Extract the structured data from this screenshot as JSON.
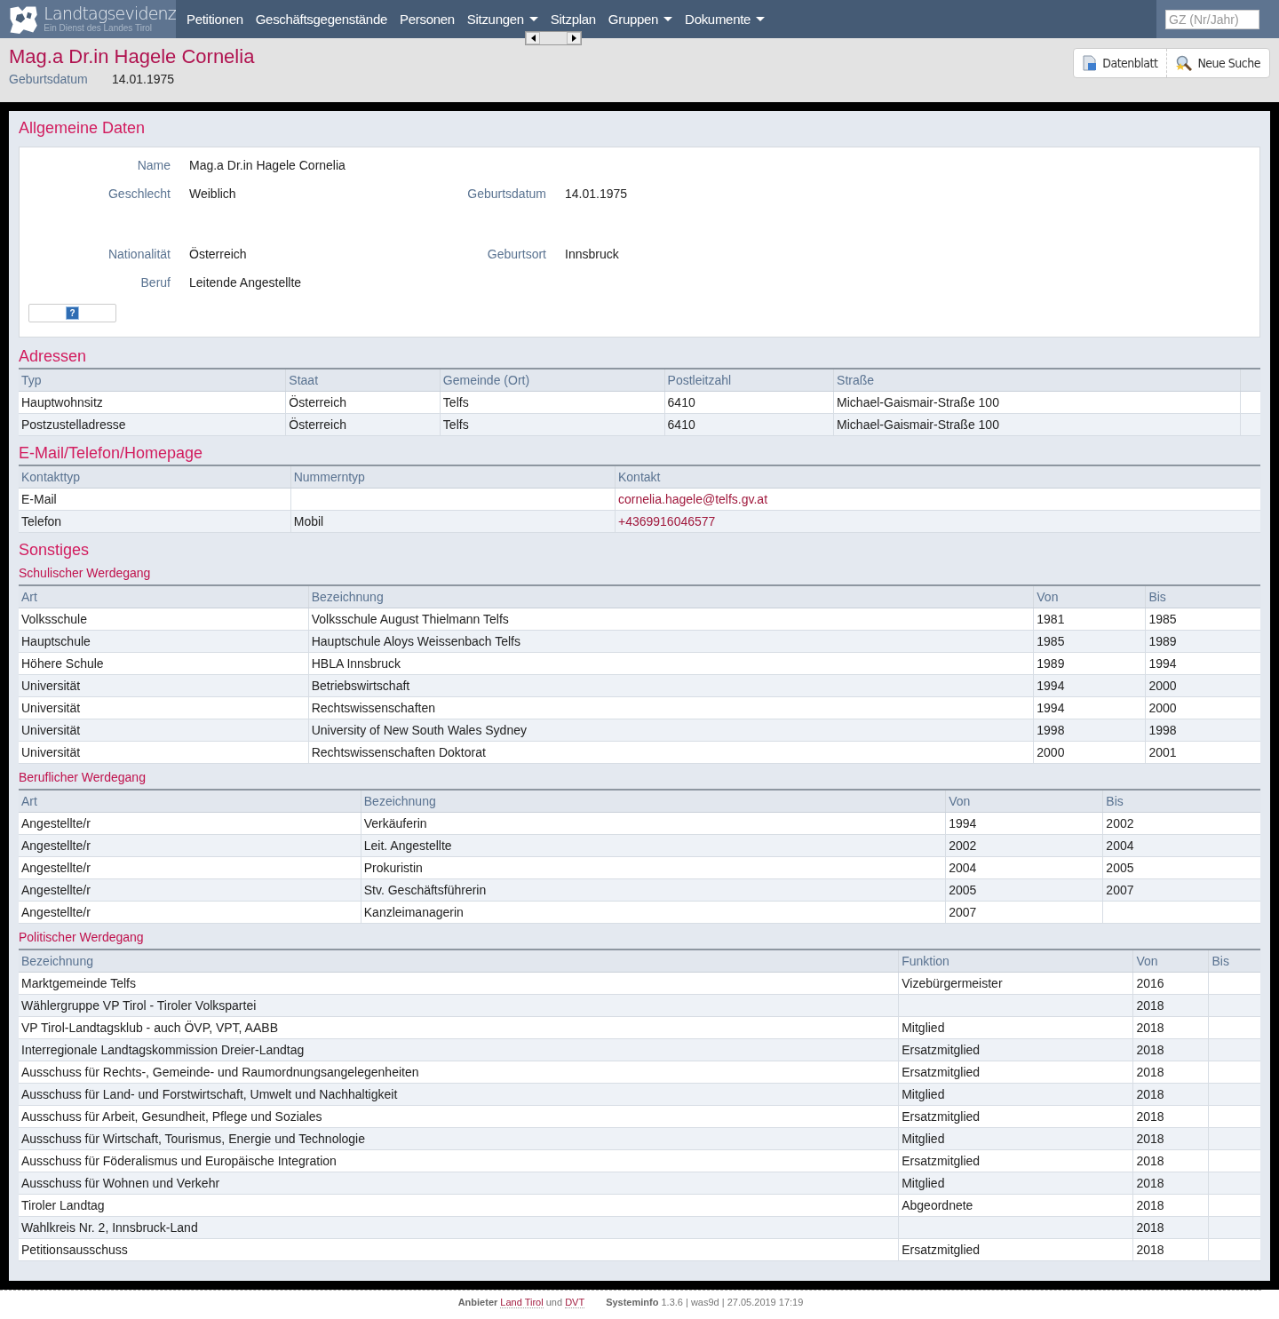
{
  "nav": {
    "brand": "Landtagsevidenz",
    "brand_sub": "Ein Dienst des Landes Tirol",
    "items": [
      {
        "label": "Petitionen",
        "dropdown": false
      },
      {
        "label": "Geschäftsgegenstände",
        "dropdown": false
      },
      {
        "label": "Personen",
        "dropdown": false
      },
      {
        "label": "Sitzungen",
        "dropdown": true
      },
      {
        "label": "Sitzplan",
        "dropdown": false
      },
      {
        "label": "Gruppen",
        "dropdown": true
      },
      {
        "label": "Dokumente",
        "dropdown": true
      }
    ],
    "search": {
      "placeholder": "GZ (Nr/Jahr)"
    }
  },
  "header": {
    "title": "Mag.a Dr.in Hagele Cornelia",
    "birth_label": "Geburtsdatum",
    "birth_value": "14.01.1975",
    "buttons": [
      "Datenblatt",
      "Neue Suche"
    ]
  },
  "general": {
    "title": "Allgemeine Daten",
    "rows": [
      [
        {
          "label": "Name",
          "value": "Mag.a Dr.in Hagele Cornelia"
        }
      ],
      [
        {
          "label": "Geschlecht",
          "value": "Weiblich"
        },
        {
          "label": "Geburtsdatum",
          "value": "14.01.1975"
        }
      ],
      [],
      [
        {
          "label": "Nationalität",
          "value": "Österreich"
        },
        {
          "label": "Geburtsort",
          "value": "Innsbruck"
        }
      ],
      [
        {
          "label": "Beruf",
          "value": "Leitende Angestellte"
        }
      ]
    ],
    "help": "?"
  },
  "addresses": {
    "title": "Adressen",
    "columns": [
      "Typ",
      "Staat",
      "Gemeinde (Ort)",
      "Postleitzahl",
      "Straße"
    ],
    "extra_column": true,
    "rows": [
      [
        "Hauptwohnsitz",
        "Österreich",
        "Telfs",
        "6410",
        "Michael-Gaismair-Straße 100"
      ],
      [
        "Postzustelladresse",
        "Österreich",
        "Telfs",
        "6410",
        "Michael-Gaismair-Straße 100"
      ]
    ]
  },
  "contacts": {
    "title": "E-Mail/Telefon/Homepage",
    "columns": [
      "Kontakttyp",
      "Nummerntyp",
      "Kontakt"
    ],
    "rows": [
      {
        "type": "E-Mail",
        "number_type": "",
        "contact": "cornelia.hagele@telfs.gv.at"
      },
      {
        "type": "Telefon",
        "number_type": "Mobil",
        "contact": "+4369916046577"
      }
    ]
  },
  "other": {
    "title": "Sonstiges",
    "tables": [
      {
        "title": "Schulischer Werdegang",
        "columns": [
          "Art",
          "Bezeichnung",
          "Von",
          "Bis"
        ],
        "rows": [
          [
            "Volksschule",
            "Volksschule August Thielmann Telfs",
            "1981",
            "1985"
          ],
          [
            "Hauptschule",
            "Hauptschule Aloys Weissenbach Telfs",
            "1985",
            "1989"
          ],
          [
            "Höhere Schule",
            "HBLA Innsbruck",
            "1989",
            "1994"
          ],
          [
            "Universität",
            "Betriebswirtschaft",
            "1994",
            "2000"
          ],
          [
            "Universität",
            "Rechtswissenschaften",
            "1994",
            "2000"
          ],
          [
            "Universität",
            "University of New South Wales Sydney",
            "1998",
            "1998"
          ],
          [
            "Universität",
            "Rechtswissenschaften Doktorat",
            "2000",
            "2001"
          ]
        ]
      },
      {
        "title": "Beruflicher Werdegang",
        "columns": [
          "Art",
          "Bezeichnung",
          "Von",
          "Bis"
        ],
        "rows": [
          [
            "Angestellte/r",
            "Verkäuferin",
            "1994",
            "2002"
          ],
          [
            "Angestellte/r",
            "Leit. Angestellte",
            "2002",
            "2004"
          ],
          [
            "Angestellte/r",
            "Prokuristin",
            "2004",
            "2005"
          ],
          [
            "Angestellte/r",
            "Stv. Geschäftsführerin",
            "2005",
            "2007"
          ],
          [
            "Angestellte/r",
            "Kanzleimanagerin",
            "2007",
            ""
          ]
        ]
      },
      {
        "title": "Politischer Werdegang",
        "columns": [
          "Bezeichnung",
          "Funktion",
          "Von",
          "Bis"
        ],
        "rows": [
          [
            "Marktgemeinde Telfs",
            "Vizebürgermeister",
            "2016",
            ""
          ],
          [
            "Wählergruppe VP Tirol - Tiroler Volkspartei",
            "",
            "2018",
            ""
          ],
          [
            "VP Tirol-Landtagsklub - auch ÖVP, VPT, AABB",
            "Mitglied",
            "2018",
            ""
          ],
          [
            "Interregionale Landtagskommission Dreier-Landtag",
            "Ersatzmitglied",
            "2018",
            ""
          ],
          [
            "Ausschuss für Rechts-, Gemeinde- und Raumordnungsangelegenheiten",
            "Ersatzmitglied",
            "2018",
            ""
          ],
          [
            "Ausschuss für Land- und Forstwirtschaft, Umwelt und Nachhaltigkeit",
            "Mitglied",
            "2018",
            ""
          ],
          [
            "Ausschuss für Arbeit, Gesundheit, Pflege und Soziales",
            "Ersatzmitglied",
            "2018",
            ""
          ],
          [
            "Ausschuss für Wirtschaft, Tourismus, Energie und Technologie",
            "Mitglied",
            "2018",
            ""
          ],
          [
            "Ausschuss für Föderalismus und Europäische Integration",
            "Ersatzmitglied",
            "2018",
            ""
          ],
          [
            "Ausschuss für Wohnen und Verkehr",
            "Mitglied",
            "2018",
            ""
          ],
          [
            "Tiroler Landtag",
            "Abgeordnete",
            "2018",
            ""
          ],
          [
            "Wahlkreis Nr. 2, Innsbruck-Land",
            "",
            "2018",
            ""
          ],
          [
            "Petitionsausschuss",
            "Ersatzmitglied",
            "2018",
            ""
          ]
        ]
      }
    ]
  },
  "footer": {
    "provider_label": "Anbieter",
    "provider_link_1": "Land Tirol",
    "conjunction": "und",
    "provider_link_2": "DVT",
    "system_label": "Systeminfo",
    "system_value": "1.3.6 | was9d | 27.05.2019 17:19"
  }
}
